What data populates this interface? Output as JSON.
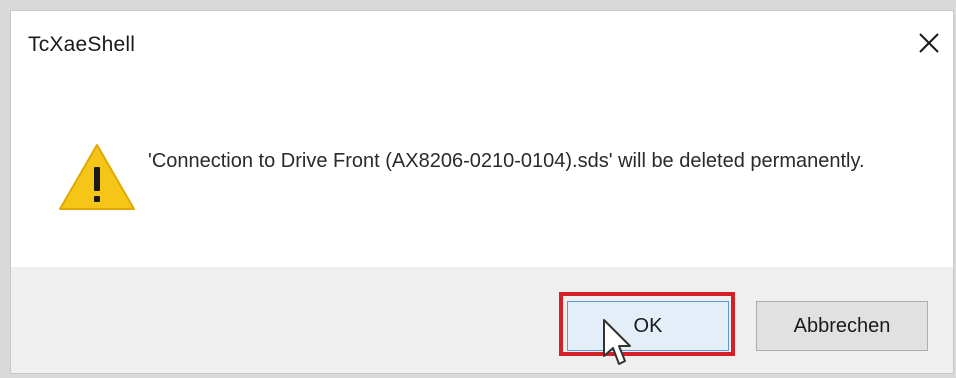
{
  "dialog": {
    "title": "TcXaeShell",
    "message": "'Connection to Drive Front (AX8206-0210-0104).sds' will be deleted permanently.",
    "icon": "warning-icon",
    "buttons": {
      "ok_label": "OK",
      "cancel_label": "Abbrechen"
    },
    "highlight_color": "#d42027",
    "warning_color": "#f5c518"
  }
}
